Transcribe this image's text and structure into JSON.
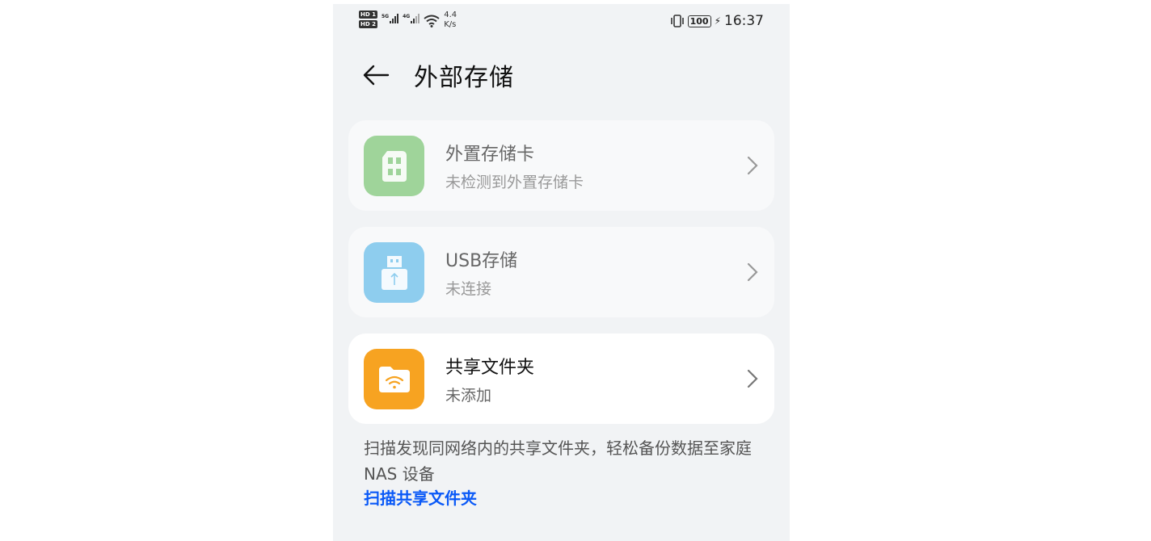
{
  "status_bar": {
    "sim1": "HD 1",
    "sim2": "HD 2",
    "net1": "5G",
    "net2": "4G",
    "speed_value": "4.4",
    "speed_unit": "K/s",
    "battery": "100",
    "time": "16:37",
    "icons": [
      "vibrate-icon",
      "battery-icon",
      "charging-icon",
      "wifi-icon",
      "signal-icon"
    ]
  },
  "header": {
    "title": "外部存储",
    "back_icon": "arrow-left-icon"
  },
  "items": [
    {
      "title": "外置存储卡",
      "subtitle": "未检测到外置存储卡",
      "icon": "sd-card-icon",
      "icon_color": "#9fd49a",
      "enabled": false
    },
    {
      "title": "USB存储",
      "subtitle": "未连接",
      "icon": "usb-drive-icon",
      "icon_color": "#8ecdee",
      "enabled": false
    },
    {
      "title": "共享文件夹",
      "subtitle": "未添加",
      "icon": "network-folder-icon",
      "icon_color": "#f7a321",
      "enabled": true
    }
  ],
  "footer": {
    "description": "扫描发现同网络内的共享文件夹，轻松备份数据至家庭 NAS 设备",
    "link": "扫描共享文件夹",
    "link_color": "#0a59f7"
  }
}
